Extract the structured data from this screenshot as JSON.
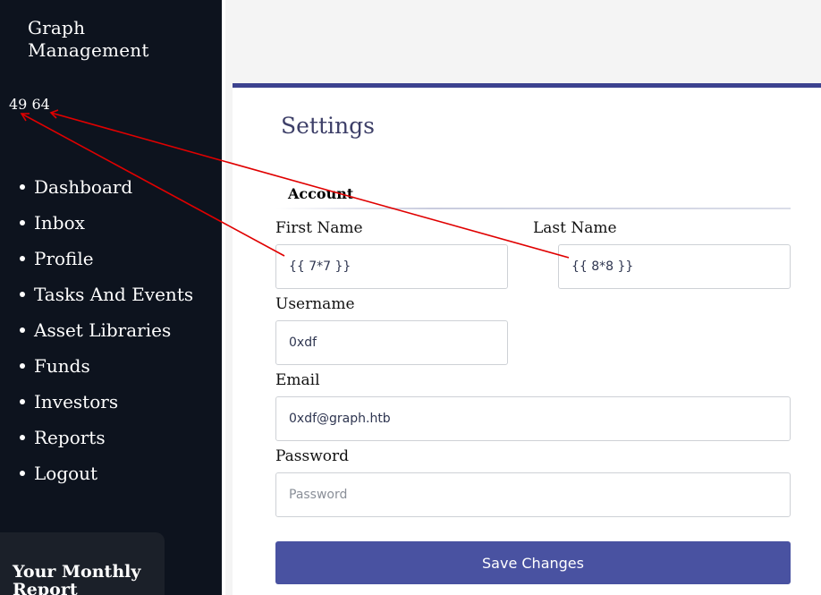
{
  "sidebar": {
    "brand": "Graph\nManagement",
    "calc_output": "49 64",
    "nav": [
      "Dashboard",
      "Inbox",
      "Profile",
      "Tasks And Events",
      "Asset Libraries",
      "Funds",
      "Investors",
      "Reports",
      "Logout"
    ],
    "report_title": "Your Monthly Report"
  },
  "main": {
    "title": "Settings",
    "tab": "Account",
    "fields": {
      "first_name": {
        "label": "First Name",
        "value": "{{ 7*7 }}"
      },
      "last_name": {
        "label": "Last Name",
        "value": "{{ 8*8 }}"
      },
      "username": {
        "label": "Username",
        "value": "0xdf"
      },
      "email": {
        "label": "Email",
        "value": "0xdf@graph.htb"
      },
      "password": {
        "label": "Password",
        "value": "",
        "placeholder": "Password"
      }
    },
    "save_label": "Save Changes"
  },
  "colors": {
    "sidebar_bg": "#0d131e",
    "accent": "#3c428f",
    "button": "#4952a1",
    "annotation_arrow": "#e00000"
  },
  "annotations": [
    "arrow-first-name-to-49",
    "arrow-last-name-to-64"
  ]
}
